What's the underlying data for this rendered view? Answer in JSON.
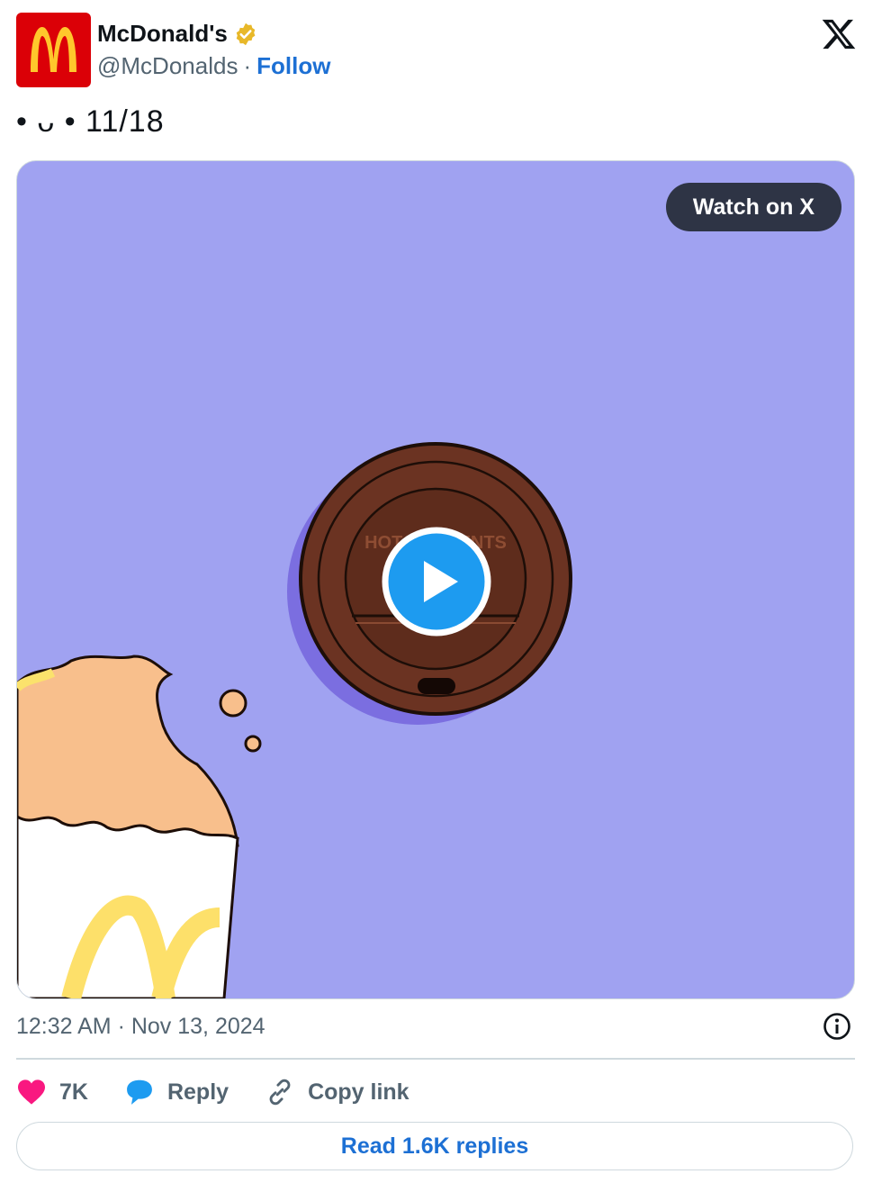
{
  "author": {
    "name": "McDonald's",
    "handle": "@McDonalds",
    "separator": "·",
    "follow_label": "Follow",
    "verified": true
  },
  "tweet": {
    "text": "• ᴗ • 11/18"
  },
  "media": {
    "watch_label": "Watch on X",
    "lid_text": "HOT CONTENTS",
    "background_color": "#a0a2f1"
  },
  "meta": {
    "timestamp": "12:32 AM · Nov 13, 2024"
  },
  "actions": {
    "like_count": "7K",
    "reply_label": "Reply",
    "copy_label": "Copy link"
  },
  "footer": {
    "read_replies_label": "Read 1.6K replies"
  },
  "colors": {
    "link": "#1d70d4",
    "heart": "#f91880",
    "reply_bubble": "#1d9bf0",
    "brand_red": "#db0007",
    "brand_yellow": "#ffc72c"
  }
}
